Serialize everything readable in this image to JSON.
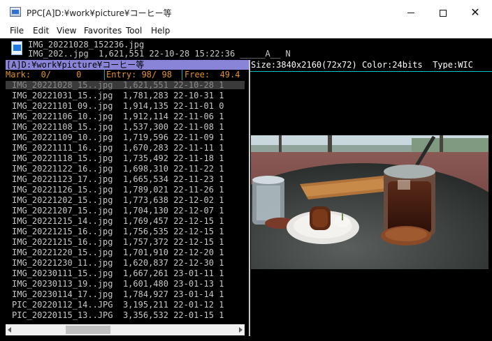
{
  "window": {
    "title": "PPC[A]D:¥work¥picture¥コーヒー等",
    "icons": {
      "app": "ppc-app-icon",
      "minimize": "minimize-icon",
      "maximize": "maximize-icon",
      "close": "close-icon"
    }
  },
  "menu": {
    "items": [
      "File",
      "Edit",
      "View",
      "Favorites",
      "Tool",
      "Help"
    ]
  },
  "info": {
    "icon": "jpeg-file-icon",
    "line1": "IMG_20221028_152236.jpg",
    "line2": "IMG_202..jpg  1,621,551 22-10-28 15:22:36 _____A__ N"
  },
  "path_bar": {
    "text": "[A]D:¥work¥picture¥コーヒー等"
  },
  "status": {
    "mark": "Mark:  0/     0",
    "entry": "Entry: 98/ 98",
    "free": "Free:  49.4"
  },
  "preview": {
    "size_info": "Size:3840x2160(72x72) Color:24bits  Type:WIC"
  },
  "files": [
    "IMG_20221028_15..jpg  1,621,551 22-10-28 1",
    "IMG_20221031_15..jpg  1,781,283 22-10-31 1",
    "IMG_20221101_09..jpg  1,914,135 22-11-01 0",
    "IMG_20221106_10..jpg  1,912,114 22-11-06 1",
    "IMG_20221108_15..jpg  1,537,300 22-11-08 1",
    "IMG_20221109_10..jpg  1,719,596 22-11-09 1",
    "IMG_20221111_16..jpg  1,670,283 22-11-11 1",
    "IMG_20221118_15..jpg  1,735,492 22-11-18 1",
    "IMG_20221122_16..jpg  1,698,310 22-11-22 1",
    "IMG_20221123_17..jpg  1,665,534 22-11-23 1",
    "IMG_20221126_15..jpg  1,789,021 22-11-26 1",
    "IMG_20221202_15..jpg  1,773,638 22-12-02 1",
    "IMG_20221207_15..jpg  1,704,130 22-12-07 1",
    "IMG_20221215_14..jpg  1,769,457 22-12-15 1",
    "IMG_20221215_16..jpg  1,756,535 22-12-15 1",
    "IMG_20221215_16..jpg  1,757,372 22-12-15 1",
    "IMG_20221220_15..jpg  1,701,910 22-12-20 1",
    "IMG_20221230_11..jpg  1,620,837 22-12-30 1",
    "IMG_20230111_15..jpg  1,667,261 23-01-11 1",
    "IMG_20230113_19..jpg  1,601,480 23-01-13 1",
    "IMG_20230114_17..jpg  1,784,927 23-01-14 1",
    "PIC_20220112_14..JPG  3,195,211 22-01-12 1",
    "PIC_20220115_13..JPG  3,356,532 22-01-15 1"
  ],
  "selected_index": 0,
  "colors": {
    "background": "#000000",
    "path_bar": "#8a84d8",
    "status_text": "#e0902a",
    "separator": "#00b0b0",
    "file_text": "#c8c8c8",
    "selected_row": "#3a3a3a"
  }
}
